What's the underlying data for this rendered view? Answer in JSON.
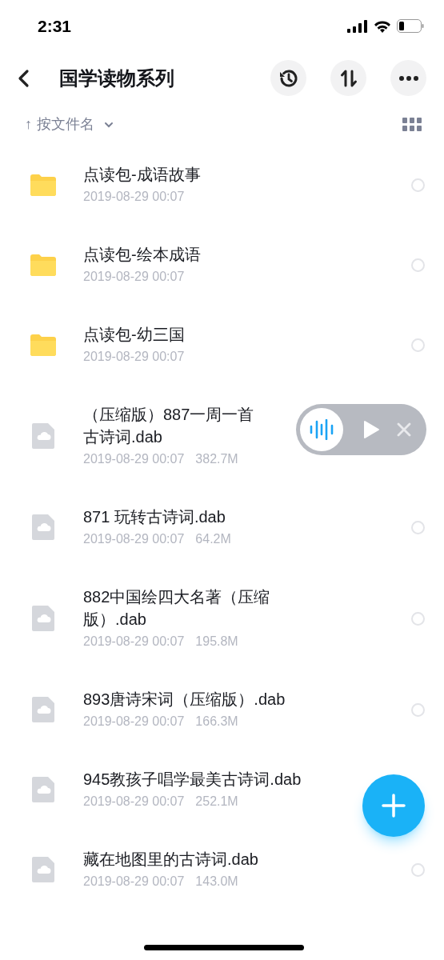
{
  "status_bar": {
    "time": "2:31"
  },
  "nav": {
    "title": "国学读物系列"
  },
  "sort": {
    "label": "按文件名",
    "arrow": "↑"
  },
  "files": [
    {
      "kind": "folder",
      "name": "点读包-成语故事",
      "date": "2019-08-29 00:07",
      "selected": false,
      "playing": false
    },
    {
      "kind": "folder",
      "name": "点读包-绘本成语",
      "date": "2019-08-29 00:07",
      "selected": false,
      "playing": false
    },
    {
      "kind": "folder",
      "name": "点读包-幼三国",
      "date": "2019-08-29 00:07",
      "selected": false,
      "playing": false
    },
    {
      "kind": "file",
      "name": "（压缩版）887一周一首古诗词.dab",
      "date": "2019-08-29 00:07",
      "size": "382.7M",
      "playing": true
    },
    {
      "kind": "file",
      "name": "871 玩转古诗词.dab",
      "date": "2019-08-29 00:07",
      "size": "64.2M",
      "selected": false,
      "playing": false
    },
    {
      "kind": "file",
      "name": "882中国绘四大名著（压缩版）.dab",
      "date": "2019-08-29 00:07",
      "size": "195.8M",
      "selected": false,
      "playing": false
    },
    {
      "kind": "file",
      "name": "893唐诗宋词（压缩版）.dab",
      "date": "2019-08-29 00:07",
      "size": "166.3M",
      "selected": false,
      "playing": false
    },
    {
      "kind": "file",
      "name": "945教孩子唱学最美古诗词.dab",
      "date": "2019-08-29 00:07",
      "size": "252.1M",
      "playing": false
    },
    {
      "kind": "file",
      "name": "藏在地图里的古诗词.dab",
      "date": "2019-08-29 00:07",
      "size": "143.0M",
      "selected": false,
      "playing": false
    }
  ]
}
